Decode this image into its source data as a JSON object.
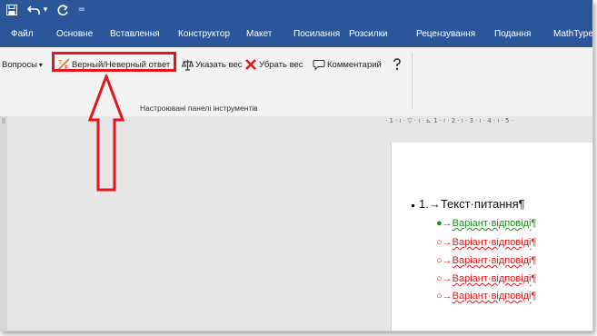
{
  "quick_access": {
    "save_icon": "save-icon",
    "undo_icon": "undo-icon",
    "undo_dropdown": "▾",
    "redo_icon": "redo-icon",
    "customize_symbol": "="
  },
  "tabs": [
    {
      "label": "Файл"
    },
    {
      "label": "Основне"
    },
    {
      "label": "Вставлення"
    },
    {
      "label": "Конструктор"
    },
    {
      "label": "Макет"
    },
    {
      "label": "Посилання"
    },
    {
      "label": "Розсилки"
    },
    {
      "label": "Рецензування"
    },
    {
      "label": "Подання"
    },
    {
      "label": "MathType"
    }
  ],
  "ribbon": {
    "buttons": {
      "questions": "Вопросы",
      "questions_arrow": "▾",
      "true_false": "Верный/Неверный ответ",
      "set_weight": "Указать вес",
      "remove_weight": "Убрать вес",
      "comment": "Комментарий"
    },
    "group_label": "Настроювані панелі інструментів"
  },
  "annotation": {
    "color": "#e2161c"
  },
  "ruler": {
    "text": "· 1 · ı · ▽ · ı · ⊾ 1 · ı · 2 · ı · 3 · ı · 4 · ı · 5 ·"
  },
  "document": {
    "question": {
      "number": "1.",
      "arrow": "→",
      "text": "Текст·питання",
      "pilcrow": "¶"
    },
    "answers": [
      {
        "bullet": "●",
        "arrow": "→",
        "text": "Варіант·відповіді",
        "pilcrow": "¶",
        "correct": true
      },
      {
        "bullet": "○",
        "arrow": "→",
        "text": "Варіант·відповіді",
        "pilcrow": "¶",
        "correct": false
      },
      {
        "bullet": "○",
        "arrow": "→",
        "text": "Варіант·відповіді",
        "pilcrow": "¶",
        "correct": false
      },
      {
        "bullet": "○",
        "arrow": "→",
        "text": "Варіант·відповіді",
        "pilcrow": "¶",
        "correct": false
      },
      {
        "bullet": "○",
        "arrow": "→",
        "text": "Варіант·відповіді",
        "pilcrow": "¶",
        "correct": false
      }
    ],
    "correct_color": "#1a8a1a",
    "wrong_color": "#e01818"
  },
  "colors": {
    "title_bar": "#2b579a",
    "ribbon": "#f3f3f3",
    "canvas": "#e6e6e6"
  }
}
